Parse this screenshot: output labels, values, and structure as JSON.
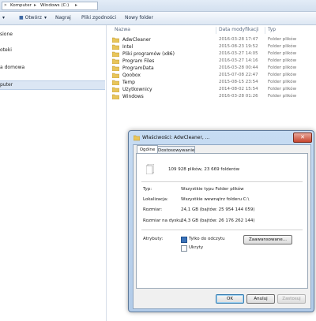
{
  "address": {
    "crumbs": [
      "Komputer",
      "Windows (C:)"
    ]
  },
  "toolbar": {
    "items": [
      "Otwórz",
      "Nagraj",
      "Pliki zgodności",
      "Nowy folder"
    ]
  },
  "nav": {
    "items": [
      "sione",
      "oteki",
      "a domowa",
      "puter"
    ]
  },
  "columns": {
    "name": "Nazwa",
    "date": "Data modyfikacji",
    "type": "Typ"
  },
  "files": [
    {
      "name": "AdwCleaner",
      "date": "2016-03-28 17:47",
      "type": "Folder plików"
    },
    {
      "name": "Intel",
      "date": "2015-08-23 19:52",
      "type": "Folder plików"
    },
    {
      "name": "Pliki programów (x86)",
      "date": "2016-03-27 14:05",
      "type": "Folder plików"
    },
    {
      "name": "Program Files",
      "date": "2016-03-27 14:16",
      "type": "Folder plików"
    },
    {
      "name": "ProgramData",
      "date": "2016-03-28 00:44",
      "type": "Folder plików"
    },
    {
      "name": "Qoobox",
      "date": "2015-07-08 22:47",
      "type": "Folder plików"
    },
    {
      "name": "Temp",
      "date": "2015-08-15 23:54",
      "type": "Folder plików"
    },
    {
      "name": "Użytkownicy",
      "date": "2014-08-02 15:54",
      "type": "Folder plików"
    },
    {
      "name": "Windows",
      "date": "2016-03-28 01:26",
      "type": "Folder plików"
    }
  ],
  "dialog": {
    "title": "Właściwości: AdwCleaner, ...",
    "close": "✕",
    "tabs": [
      "Ogólne",
      "Dostosowywanie"
    ],
    "summary": "109 928 plików, 23 669 folderów",
    "props": [
      {
        "label": "Typ:",
        "value": "Wszystkie typu Folder plików"
      },
      {
        "label": "Lokalizacja:",
        "value": "Wszystkie wewnątrz folderu C:\\"
      },
      {
        "label": "Rozmiar:",
        "value": "24,1 GB (bajtów: 25 954 144 059)"
      },
      {
        "label": "Rozmiar na dysku:",
        "value": "24,3 GB (bajtów: 26 176 262 144)"
      }
    ],
    "attributes_label": "Atrybuty:",
    "readonly_label": "Tylko do odczytu",
    "hidden_label": "Ukryty",
    "advanced_button": "Zaawansowane...",
    "ok_button": "OK",
    "cancel_button": "Anuluj",
    "apply_button": "Zastosuj"
  },
  "colors": {
    "folder": "#e8c55a",
    "selection": "#dbe6f4",
    "accent": "#3b73b9"
  }
}
